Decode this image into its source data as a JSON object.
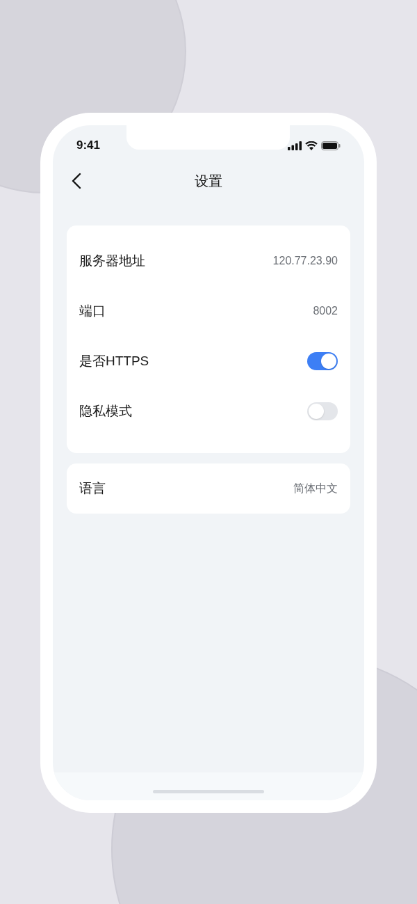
{
  "status_bar": {
    "time": "9:41"
  },
  "nav": {
    "title": "设置"
  },
  "groups": [
    {
      "rows": [
        {
          "kind": "value",
          "label": "服务器地址",
          "value": "120.77.23.90"
        },
        {
          "kind": "value",
          "label": "端口",
          "value": "8002"
        },
        {
          "kind": "toggle",
          "label": "是否HTTPS",
          "on": true
        },
        {
          "kind": "toggle",
          "label": "隐私模式",
          "on": false
        }
      ]
    },
    {
      "rows": [
        {
          "kind": "value",
          "label": "语言",
          "value": "简体中文"
        }
      ]
    }
  ]
}
